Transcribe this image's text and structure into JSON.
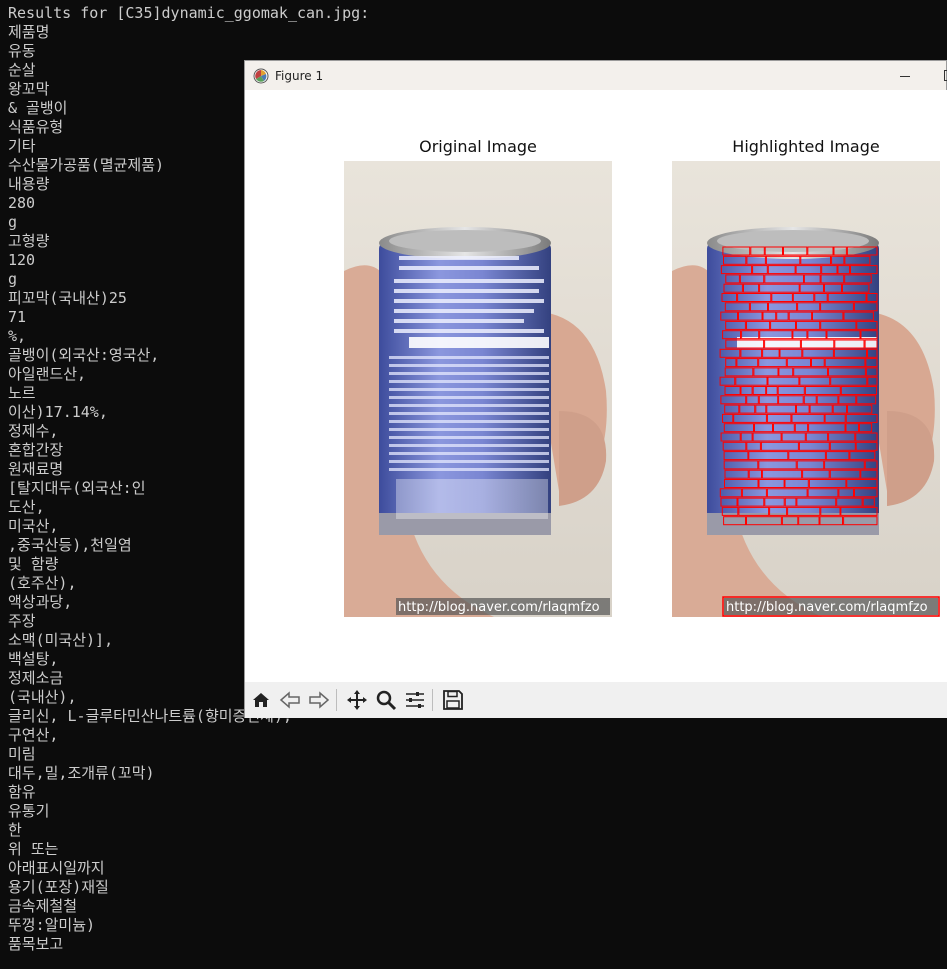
{
  "terminal": {
    "partial_top_line": "     ..g          .  . .   ..  .   .. . .  .  .    .  . .  .,  ...   ..  . .. .. . , .  .. ..   .. . .  .. ....",
    "lines": [
      "Results for [C35]dynamic_ggomak_can.jpg:",
      "제품명",
      "유동",
      "순살",
      "왕꼬막",
      "& 골뱅이",
      "식품유형",
      "기타",
      "수산물가공품(멸균제품)",
      "내용량",
      "280",
      "g",
      "고형량",
      "120",
      "g",
      "피꼬막(국내산)25",
      "71",
      "%,",
      "골뱅이(외국산:영국산,",
      "아일랜드산,",
      "노르",
      "이산)17.14%,",
      "정제수,",
      "혼합간장",
      "원재료명",
      "[탈지대두(외국산:인",
      "도산,",
      "미국산,",
      ",중국산등),천일염",
      "및 함량",
      "(호주산),",
      "액상과당,",
      "주장",
      "소맥(미국산)],",
      "백설탕,",
      "정제소금",
      "(국내산),",
      "글리신, L-글루타민산나트륨(향미증진제),",
      "구연산,",
      "미림",
      "대두,밀,조개류(꼬막)",
      "함유",
      "유통기",
      "한",
      "위 또는",
      "아래표시일까지",
      "용기(포장)재질",
      "금속제철철",
      "뚜껑:알미늄)",
      "품목보고"
    ]
  },
  "figure_window": {
    "title": "Figure 1",
    "left_subplot_title": "Original Image",
    "right_subplot_title": "Highlighted Image",
    "watermark": "http://blog.naver.com/rlaqmfzo"
  },
  "toolbar": {
    "tools": [
      "home-icon",
      "back-icon",
      "forward-icon",
      "pan-icon",
      "zoom-icon",
      "configure-subplots-icon",
      "save-icon"
    ]
  },
  "colors": {
    "terminal_bg": "#0c0c0c",
    "terminal_text": "#cccccc",
    "highlight_box": "#ff0000",
    "can_blue": "#6f7fcf"
  }
}
